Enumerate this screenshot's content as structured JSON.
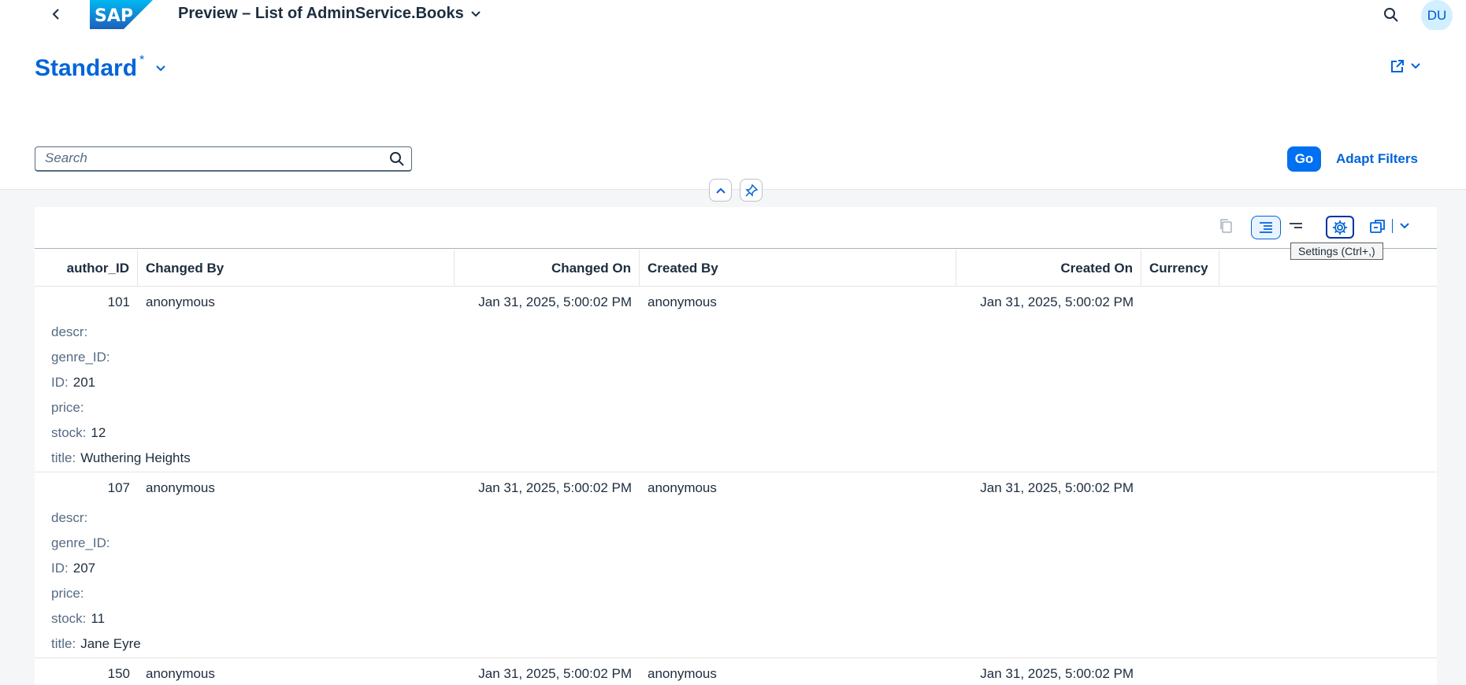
{
  "shell": {
    "logo": "SAP",
    "title": "Preview – List of AdminService.Books",
    "avatar_initials": "DU"
  },
  "header": {
    "variant_name": "Standard",
    "variant_modified": "*",
    "search_placeholder": "Search",
    "go_label": "Go",
    "adapt_filters_label": "Adapt Filters"
  },
  "toolbar": {
    "settings_tooltip": "Settings (Ctrl+,)"
  },
  "table": {
    "columns": [
      "author_ID",
      "Changed By",
      "Changed On",
      "Created By",
      "Created On",
      "Currency"
    ],
    "rows": [
      {
        "author_ID": "101",
        "changed_by": "anonymous",
        "changed_on": "Jan 31, 2025, 5:00:02 PM",
        "created_by": "anonymous",
        "created_on": "Jan 31, 2025, 5:00:02 PM",
        "popin": [
          {
            "label": "descr:",
            "value": ""
          },
          {
            "label": "genre_ID:",
            "value": ""
          },
          {
            "label": "ID:",
            "value": "201"
          },
          {
            "label": "price:",
            "value": ""
          },
          {
            "label": "stock:",
            "value": "12"
          },
          {
            "label": "title:",
            "value": "Wuthering Heights"
          }
        ]
      },
      {
        "author_ID": "107",
        "changed_by": "anonymous",
        "changed_on": "Jan 31, 2025, 5:00:02 PM",
        "created_by": "anonymous",
        "created_on": "Jan 31, 2025, 5:00:02 PM",
        "popin": [
          {
            "label": "descr:",
            "value": ""
          },
          {
            "label": "genre_ID:",
            "value": ""
          },
          {
            "label": "ID:",
            "value": "207"
          },
          {
            "label": "price:",
            "value": ""
          },
          {
            "label": "stock:",
            "value": "11"
          },
          {
            "label": "title:",
            "value": "Jane Eyre"
          }
        ]
      },
      {
        "author_ID": "150",
        "changed_by": "anonymous",
        "changed_on": "Jan 31, 2025, 5:00:02 PM",
        "created_by": "anonymous",
        "created_on": "Jan 31, 2025, 5:00:02 PM",
        "popin": []
      }
    ]
  }
}
